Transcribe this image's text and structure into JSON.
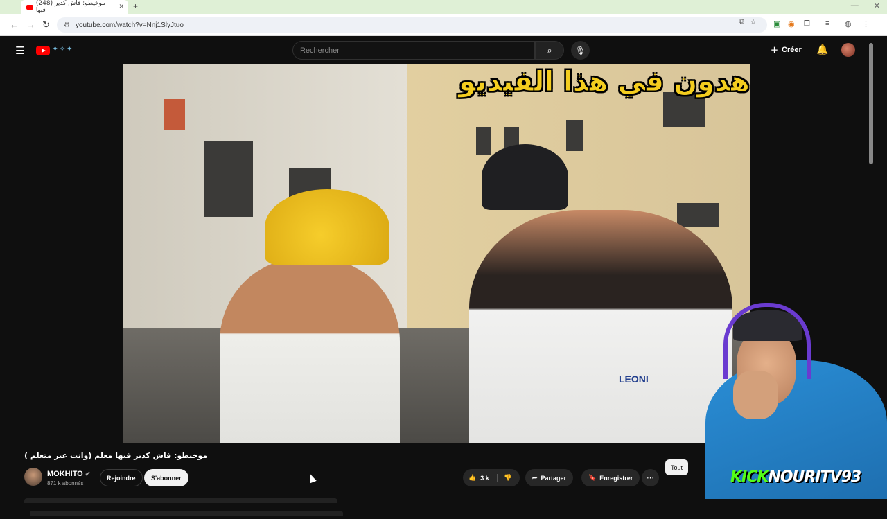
{
  "browser": {
    "tab_title": "(248) موخيطو: فاش كدير فيها",
    "tab_close": "✕",
    "new_tab": "+",
    "window_controls": [
      "—",
      "✕"
    ],
    "url": "youtube.com/watch?v=Nnj1SlyJtuo"
  },
  "youtube": {
    "search_placeholder": "Rechercher",
    "create_label": "Créer",
    "video_overlay_text": "تشاهدون في هذا الفيديو",
    "shirt_logo": "LEONI",
    "video_title": "موخيطو: فاش كدير فيها معلم (وانت غير متعلم )",
    "channel": {
      "name": "MOKHITO",
      "verified": "✔",
      "subscribers": "871 k abonnés"
    },
    "join_label": "Rejoindre",
    "subscribe_label": "S'abonner",
    "like_count": "3 k",
    "share_label": "Partager",
    "save_label": "Enregistrer",
    "chip_all": "Tout"
  },
  "stream_overlay": {
    "kick_part": "KICK",
    "channel_part": "NOURITV93"
  },
  "colors": {
    "yt_red": "#ff0000",
    "kick_green": "#53fc18",
    "overlay_yellow": "#f4cd1e"
  }
}
